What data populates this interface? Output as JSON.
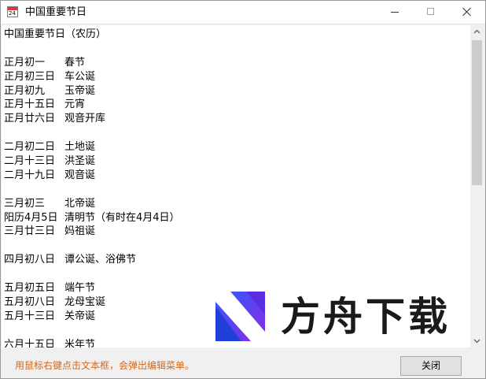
{
  "window": {
    "title": "中国重要节日",
    "icon": "calendar-icon",
    "icon_day": "24"
  },
  "controls": {
    "minimize_icon": "minimize-icon",
    "maximize_icon": "maximize-icon",
    "close_icon": "close-icon"
  },
  "content": {
    "lines": [
      {
        "a": "中国重要节日（农历）",
        "b": ""
      },
      {
        "a": "",
        "b": ""
      },
      {
        "a": "正月初一",
        "b": "春节"
      },
      {
        "a": "正月初三日",
        "b": "车公诞"
      },
      {
        "a": "正月初九",
        "b": "玉帝诞"
      },
      {
        "a": "正月十五日",
        "b": "元宵"
      },
      {
        "a": "正月廿六日",
        "b": "观音开库"
      },
      {
        "a": "",
        "b": ""
      },
      {
        "a": "二月初二日",
        "b": "土地诞"
      },
      {
        "a": "二月十三日",
        "b": "洪圣诞"
      },
      {
        "a": "二月十九日",
        "b": "观音诞"
      },
      {
        "a": "",
        "b": ""
      },
      {
        "a": "三月初三",
        "b": "北帝诞"
      },
      {
        "a": "阳历4月5日",
        "b": "清明节（有时在4月4日）"
      },
      {
        "a": "三月廿三日",
        "b": "妈祖诞"
      },
      {
        "a": "",
        "b": ""
      },
      {
        "a": "四月初八日",
        "b": "谭公诞、浴佛节"
      },
      {
        "a": "",
        "b": ""
      },
      {
        "a": "五月初五日",
        "b": "端午节"
      },
      {
        "a": "五月初八日",
        "b": "龙母宝诞"
      },
      {
        "a": "五月十三日",
        "b": "关帝诞"
      },
      {
        "a": "",
        "b": ""
      },
      {
        "a": "六月十五日",
        "b": "米年节"
      }
    ]
  },
  "status": {
    "hint": "用鼠标右键点击文本框，会弹出编辑菜单。"
  },
  "buttons": {
    "close_label": "关闭"
  },
  "watermark": {
    "text": "方舟下载",
    "logo_colors": [
      "#2d5bff",
      "#7b2dff",
      "#ffffff"
    ],
    "accent": "#f5a623"
  },
  "colors": {
    "hint": "#d2691e"
  }
}
